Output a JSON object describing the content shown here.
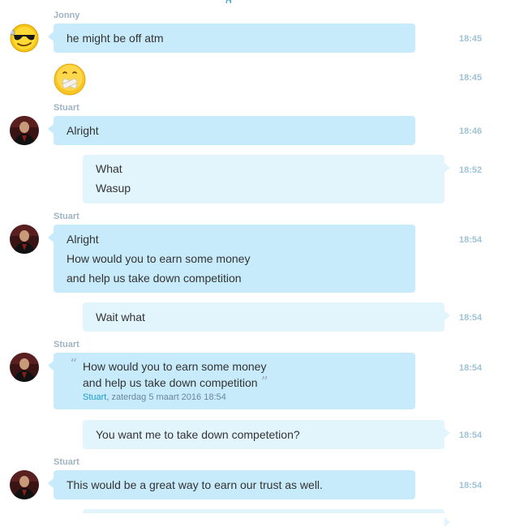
{
  "header": {
    "partial_link_text": "g"
  },
  "messages": {
    "m1": {
      "sender": "Jonny",
      "lines": [
        "he might be off atm"
      ],
      "time": "18:45"
    },
    "m2": {
      "emoticon": "zipped-mouth-emoticon",
      "time": "18:45"
    },
    "m3": {
      "sender": "Stuart",
      "lines": [
        "Alright"
      ],
      "time": "18:46"
    },
    "m4": {
      "lines": [
        "What",
        "Wasup"
      ],
      "time": "18:52"
    },
    "m5": {
      "sender": "Stuart",
      "lines": [
        "Alright",
        "How would you to earn some money",
        "and help us take down competition"
      ],
      "time": "18:54"
    },
    "m6": {
      "lines": [
        "Wait what"
      ],
      "time": "18:54"
    },
    "m7": {
      "sender": "Stuart",
      "quote": {
        "open_mark": "“",
        "close_mark": "”",
        "lines": [
          "How would you to earn some money",
          "and help us take down competition"
        ],
        "author": "Stuart",
        "date": ", zaterdag 5 maart 2016 18:54"
      },
      "time": "18:54"
    },
    "m8": {
      "lines": [
        "You want me to take down competetion?"
      ],
      "time": "18:54"
    },
    "m9": {
      "sender": "Stuart",
      "lines": [
        "This would be a great way to earn our trust as well."
      ],
      "time": "18:54"
    }
  },
  "colors": {
    "incoming_bubble": "#c7ebfb",
    "outgoing_bubble": "#e2f5fd",
    "timestamp": "#9fc3d6",
    "sender_name": "#9fb3c2",
    "quote_author": "#1d9bd1"
  }
}
